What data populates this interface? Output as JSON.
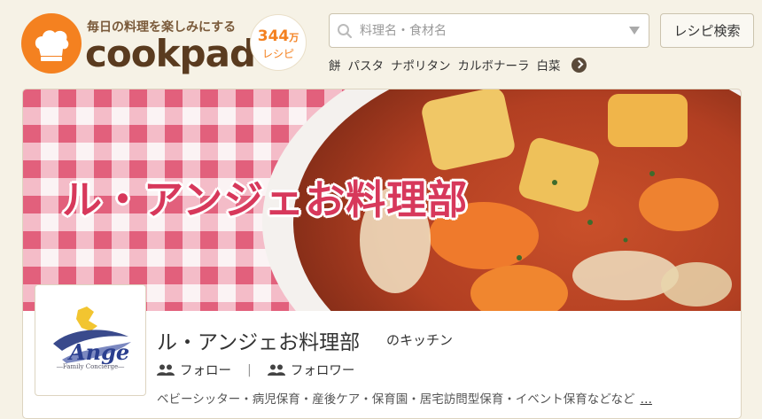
{
  "header": {
    "tagline": "毎日の料理を楽しみにする",
    "logo_text": "cookpad",
    "recipe_count": "344",
    "recipe_count_unit": "万",
    "recipe_count_label": "レシピ"
  },
  "search": {
    "placeholder": "料理名・食材名",
    "button_label": "レシピ検索"
  },
  "keywords": [
    "餅",
    "パスタ",
    "ナポリタン",
    "カルボナーラ",
    "白菜"
  ],
  "kitchen": {
    "banner_title": "ル・アンジェお料理部",
    "name": "ル・アンジェお料理部",
    "name_suffix": "のキッチン",
    "follow_label": "フォロー",
    "follower_label": "フォロワー",
    "separator": "|",
    "description": "ベビーシッター・病児保育・産後ケア・保育園・居宅訪問型保育・イベント保育などなど",
    "more_label": "…",
    "avatar_logo_text": "Ange",
    "avatar_sub_text": "―Family Concierge―"
  },
  "colors": {
    "brand_orange": "#f48120",
    "logo_brown": "#5a3b1f",
    "banner_title": "#d7385b",
    "background": "#f6f2e6"
  }
}
